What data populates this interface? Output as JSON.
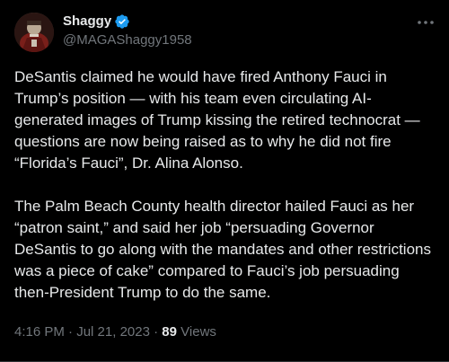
{
  "author": {
    "display_name": "Shaggy",
    "handle": "@MAGAShaggy1958",
    "verified": true
  },
  "post": {
    "paragraphs": [
      "DeSantis claimed he would have fired Anthony Fauci in Trump’s position — with his team even circulating AI-generated images of Trump kissing the retired technocrat — questions are now being raised as to why he did not fire “Florida’s Fauci”, Dr. Alina Alonso.",
      "The Palm Beach County health director hailed Fauci as her “patron saint,” and said her job “persuading Governor DeSantis to go along with the mandates and other restrictions was a piece of cake” compared to Fauci’s job persuading then-President Trump to do the same."
    ]
  },
  "meta": {
    "time": "4:16 PM",
    "separator": "·",
    "date": "Jul 21, 2023",
    "views_count": "89",
    "views_label": "Views"
  },
  "icons": {
    "verified": "verified-badge-icon",
    "more": "more-options-icon"
  },
  "colors": {
    "background": "#000000",
    "primary_text": "#e7e9ea",
    "secondary_text": "#71767b",
    "verified_blue": "#1d9bf0"
  }
}
